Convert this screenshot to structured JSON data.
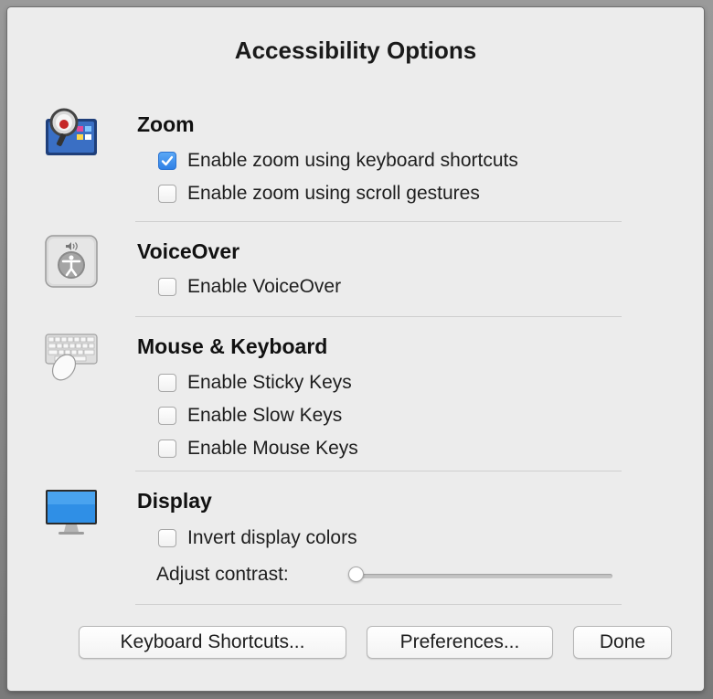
{
  "dialog": {
    "title": "Accessibility Options"
  },
  "zoom": {
    "icon": "zoom-magnifier-icon",
    "title": "Zoom",
    "options": [
      {
        "label": "Enable zoom using keyboard shortcuts",
        "checked": true
      },
      {
        "label": "Enable zoom using scroll gestures",
        "checked": false
      }
    ]
  },
  "voiceover": {
    "icon": "voiceover-accessibility-icon",
    "title": "VoiceOver",
    "options": [
      {
        "label": "Enable VoiceOver",
        "checked": false
      }
    ]
  },
  "mouse_keyboard": {
    "icon": "keyboard-mouse-icon",
    "title": "Mouse & Keyboard",
    "options": [
      {
        "label": "Enable Sticky Keys",
        "checked": false
      },
      {
        "label": "Enable Slow Keys",
        "checked": false
      },
      {
        "label": "Enable Mouse Keys",
        "checked": false
      }
    ]
  },
  "display": {
    "icon": "display-monitor-icon",
    "title": "Display",
    "options": [
      {
        "label": "Invert display colors",
        "checked": false
      }
    ],
    "contrast_label": "Adjust contrast:",
    "contrast_value": 0
  },
  "buttons": {
    "keyboard_shortcuts": "Keyboard Shortcuts...",
    "preferences": "Preferences...",
    "done": "Done"
  },
  "colors": {
    "accent": "#2f80e6",
    "dialog_bg": "#ececec"
  }
}
